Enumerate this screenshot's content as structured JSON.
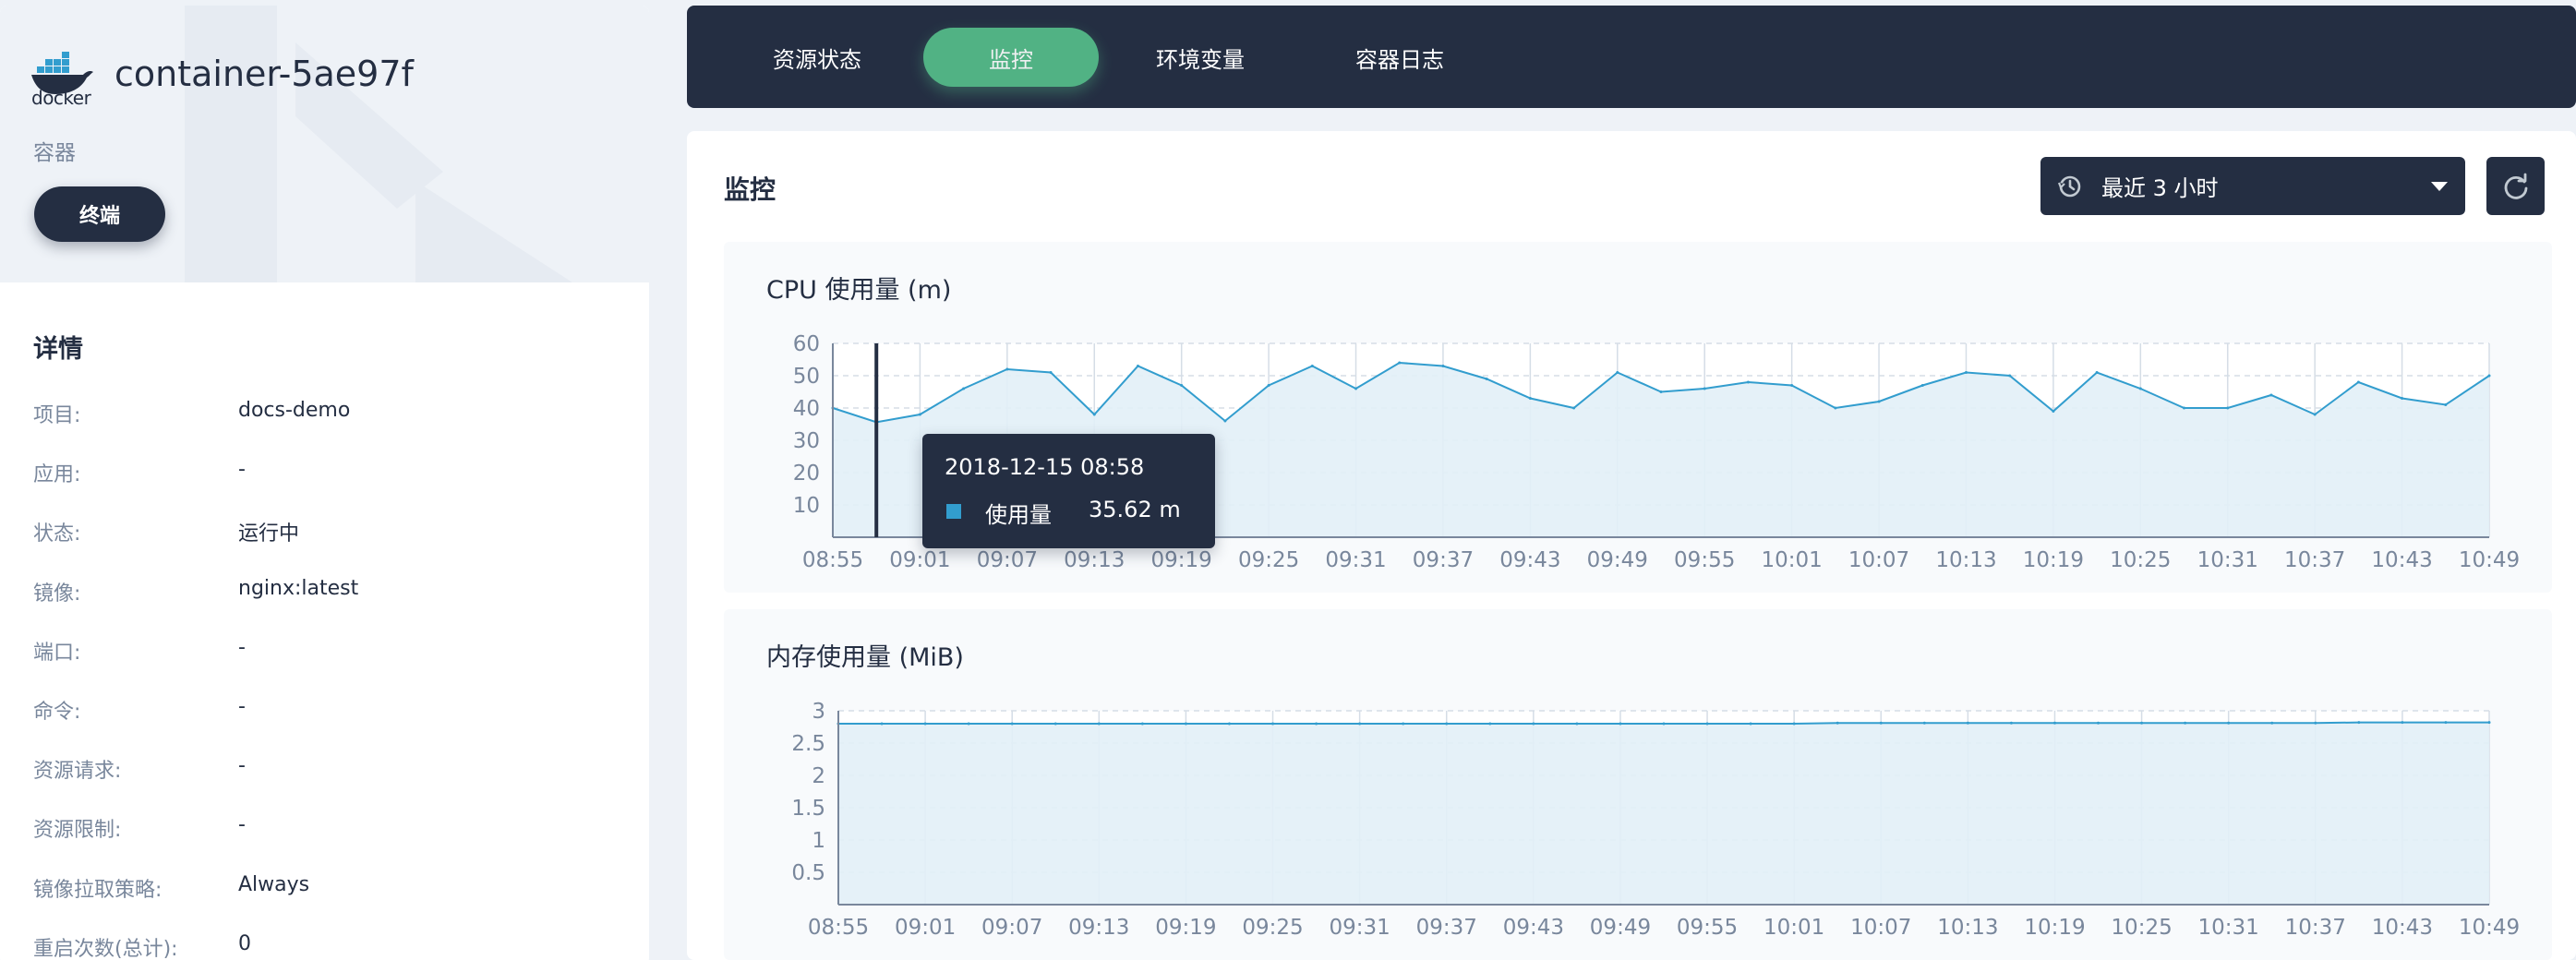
{
  "container": {
    "name": "container-5ae97f",
    "logo_text": "docker",
    "type": "容器",
    "terminal_label": "终端"
  },
  "details": {
    "title": "详情",
    "rows": [
      {
        "key": "项目:",
        "value": "docs-demo"
      },
      {
        "key": "应用:",
        "value": "-"
      },
      {
        "key": "状态:",
        "value": "运行中"
      },
      {
        "key": "镜像:",
        "value": "nginx:latest"
      },
      {
        "key": "端口:",
        "value": "-"
      },
      {
        "key": "命令:",
        "value": "-"
      },
      {
        "key": "资源请求:",
        "value": "-"
      },
      {
        "key": "资源限制:",
        "value": "-"
      },
      {
        "key": "镜像拉取策略:",
        "value": "Always"
      },
      {
        "key": "重启次数(总计):",
        "value": "0"
      }
    ]
  },
  "tabs": [
    {
      "label": "资源状态",
      "active": false
    },
    {
      "label": "监控",
      "active": true
    },
    {
      "label": "环境变量",
      "active": false
    },
    {
      "label": "容器日志",
      "active": false
    }
  ],
  "monitor": {
    "title": "监控",
    "time_range": "最近 3 小时"
  },
  "colors": {
    "dark": "#242e42",
    "accent_green": "#55bc8a",
    "series_line": "#329dce",
    "series_fill": "#e2eff7"
  },
  "tooltip": {
    "time": "2018-12-15 08:58",
    "series": "使用量",
    "value": "35.62 m"
  },
  "chart_data": [
    {
      "type": "area",
      "title": "CPU 使用量 (m)",
      "ylim": [
        0,
        60
      ],
      "yticks": [
        "10",
        "20",
        "30",
        "40",
        "50",
        "60"
      ],
      "xticks": [
        "08:55",
        "09:01",
        "09:07",
        "09:13",
        "09:19",
        "09:25",
        "09:31",
        "09:37",
        "09:43",
        "09:49",
        "09:55",
        "10:01",
        "10:07",
        "10:13",
        "10:19",
        "10:25",
        "10:31",
        "10:37",
        "10:43",
        "10:49"
      ],
      "x_start": "08:55",
      "x_step_minutes": 3,
      "series": [
        {
          "name": "使用量",
          "values": [
            40,
            35.62,
            38,
            46,
            52,
            51,
            38,
            53,
            47,
            36,
            47,
            53,
            46,
            54,
            53,
            49,
            43,
            40,
            51,
            45,
            46,
            48,
            47,
            40,
            42,
            47,
            51,
            50,
            39,
            51,
            46,
            40,
            40,
            44,
            38,
            48,
            43,
            41,
            50
          ]
        }
      ],
      "cursor_x": "08:58",
      "grid": true
    },
    {
      "type": "area",
      "title": "内存使用量 (MiB)",
      "ylim": [
        0,
        3
      ],
      "yticks": [
        "0.5",
        "1",
        "1.5",
        "2",
        "2.5",
        "3"
      ],
      "xticks": [
        "08:55",
        "09:01",
        "09:07",
        "09:13",
        "09:19",
        "09:25",
        "09:31",
        "09:37",
        "09:43",
        "09:49",
        "09:55",
        "10:01",
        "10:07",
        "10:13",
        "10:19",
        "10:25",
        "10:31",
        "10:37",
        "10:43",
        "10:49"
      ],
      "x_start": "08:55",
      "x_step_minutes": 3,
      "series": [
        {
          "name": "使用量",
          "values": [
            2.8,
            2.8,
            2.8,
            2.8,
            2.8,
            2.8,
            2.8,
            2.8,
            2.8,
            2.8,
            2.8,
            2.8,
            2.8,
            2.8,
            2.8,
            2.8,
            2.8,
            2.8,
            2.8,
            2.8,
            2.8,
            2.8,
            2.8,
            2.81,
            2.81,
            2.81,
            2.81,
            2.81,
            2.81,
            2.81,
            2.81,
            2.81,
            2.81,
            2.81,
            2.81,
            2.82,
            2.82,
            2.82,
            2.82
          ]
        }
      ],
      "grid": true
    }
  ]
}
